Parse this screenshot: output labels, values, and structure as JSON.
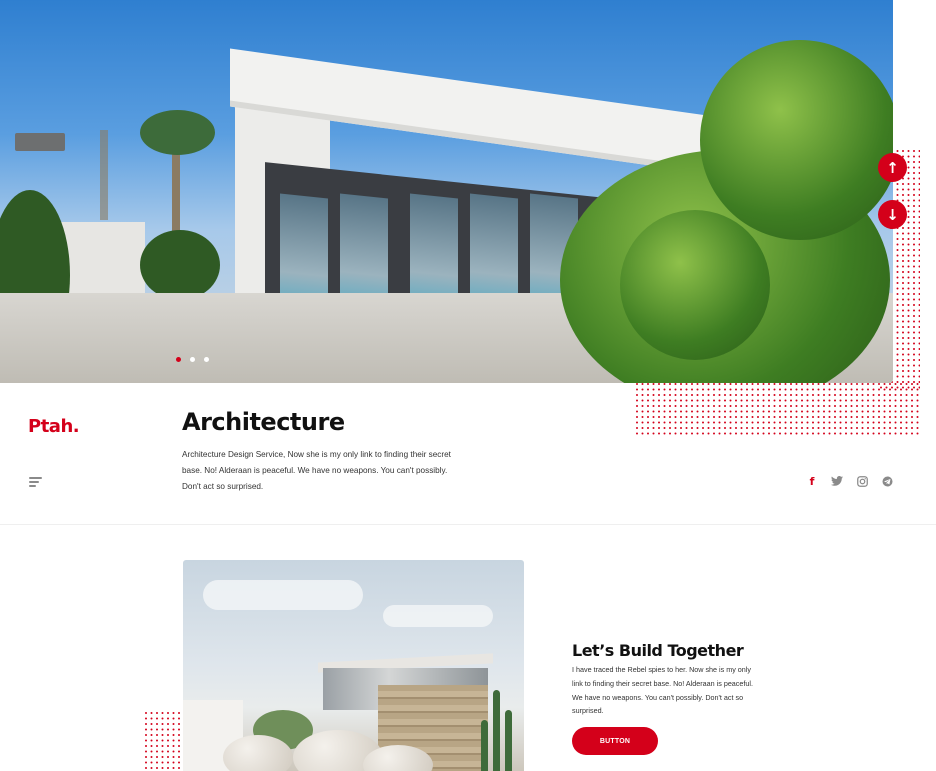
{
  "hero": {
    "slides_count": 3,
    "active_slide": 1,
    "up_arrow": "↑",
    "down_arrow": "↓"
  },
  "brand": {
    "logo_text": "Ptah."
  },
  "info": {
    "title": "Architecture",
    "description": "Architecture Design Service, Now she is my only link to finding their secret base. No! Alderaan is peaceful. We have no weapons. You can't possibly. Don't act so surprised."
  },
  "socials": [
    {
      "name": "facebook",
      "glyph": "f"
    },
    {
      "name": "twitter",
      "glyph": "🐦"
    },
    {
      "name": "instagram",
      "glyph": "◙"
    },
    {
      "name": "telegram",
      "glyph": "➤"
    }
  ],
  "feature": {
    "title": "Let’s Build Together",
    "description": "I have traced the Rebel spies to her. Now she is my only link to finding their secret base. No! Alderaan is peaceful. We have no weapons. You can't possibly. Don't act so surprised.",
    "button_label": "BUTTON"
  },
  "colors": {
    "accent": "#d4001a",
    "icon_gray": "#8a8a8a"
  }
}
